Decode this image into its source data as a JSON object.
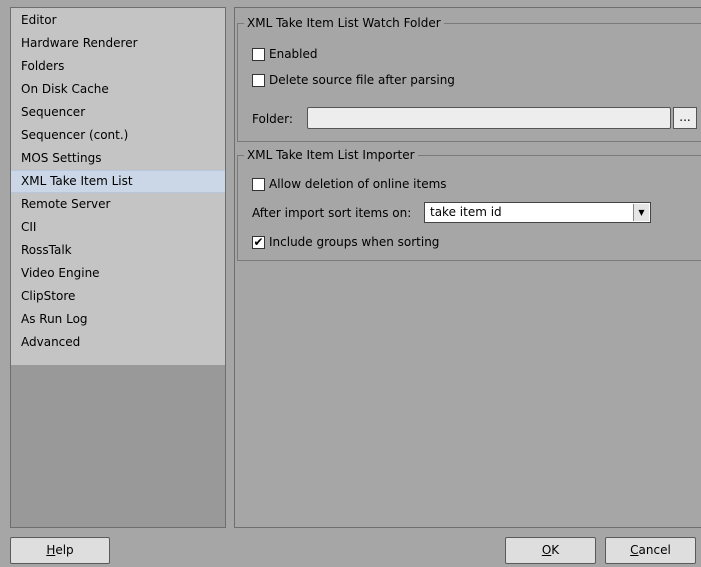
{
  "sidebar": {
    "items": [
      {
        "label": "Editor"
      },
      {
        "label": "Hardware Renderer"
      },
      {
        "label": "Folders"
      },
      {
        "label": "On Disk Cache"
      },
      {
        "label": "Sequencer"
      },
      {
        "label": "Sequencer (cont.)"
      },
      {
        "label": "MOS Settings"
      },
      {
        "label": "XML Take Item List",
        "selected": true
      },
      {
        "label": "Remote Server"
      },
      {
        "label": "CII"
      },
      {
        "label": "RossTalk"
      },
      {
        "label": "Video Engine"
      },
      {
        "label": "ClipStore"
      },
      {
        "label": "As Run Log"
      },
      {
        "label": "Advanced"
      }
    ]
  },
  "watch_folder": {
    "title": "XML Take Item List Watch Folder",
    "enabled_label": "Enabled",
    "enabled_checked": false,
    "delete_label": "Delete source file after parsing",
    "delete_checked": false,
    "folder_label": "Folder:",
    "folder_value": "",
    "browse_label": "..."
  },
  "importer": {
    "title": "XML Take Item List Importer",
    "allow_deletion_label": "Allow deletion of online items",
    "allow_deletion_checked": false,
    "sort_label": "After import sort items on:",
    "sort_value": "take item id",
    "include_groups_label": "Include groups when sorting",
    "include_groups_checked": true
  },
  "buttons": {
    "help_accel": "H",
    "help_rest": "elp",
    "ok_accel": "O",
    "ok_rest": "K",
    "cancel_accel": "C",
    "cancel_rest": "ancel"
  },
  "colors": {
    "background": "#a6a6a6",
    "sidebar_list": "#c4c4c4",
    "sidebar_selected": "#cbd6e6"
  }
}
